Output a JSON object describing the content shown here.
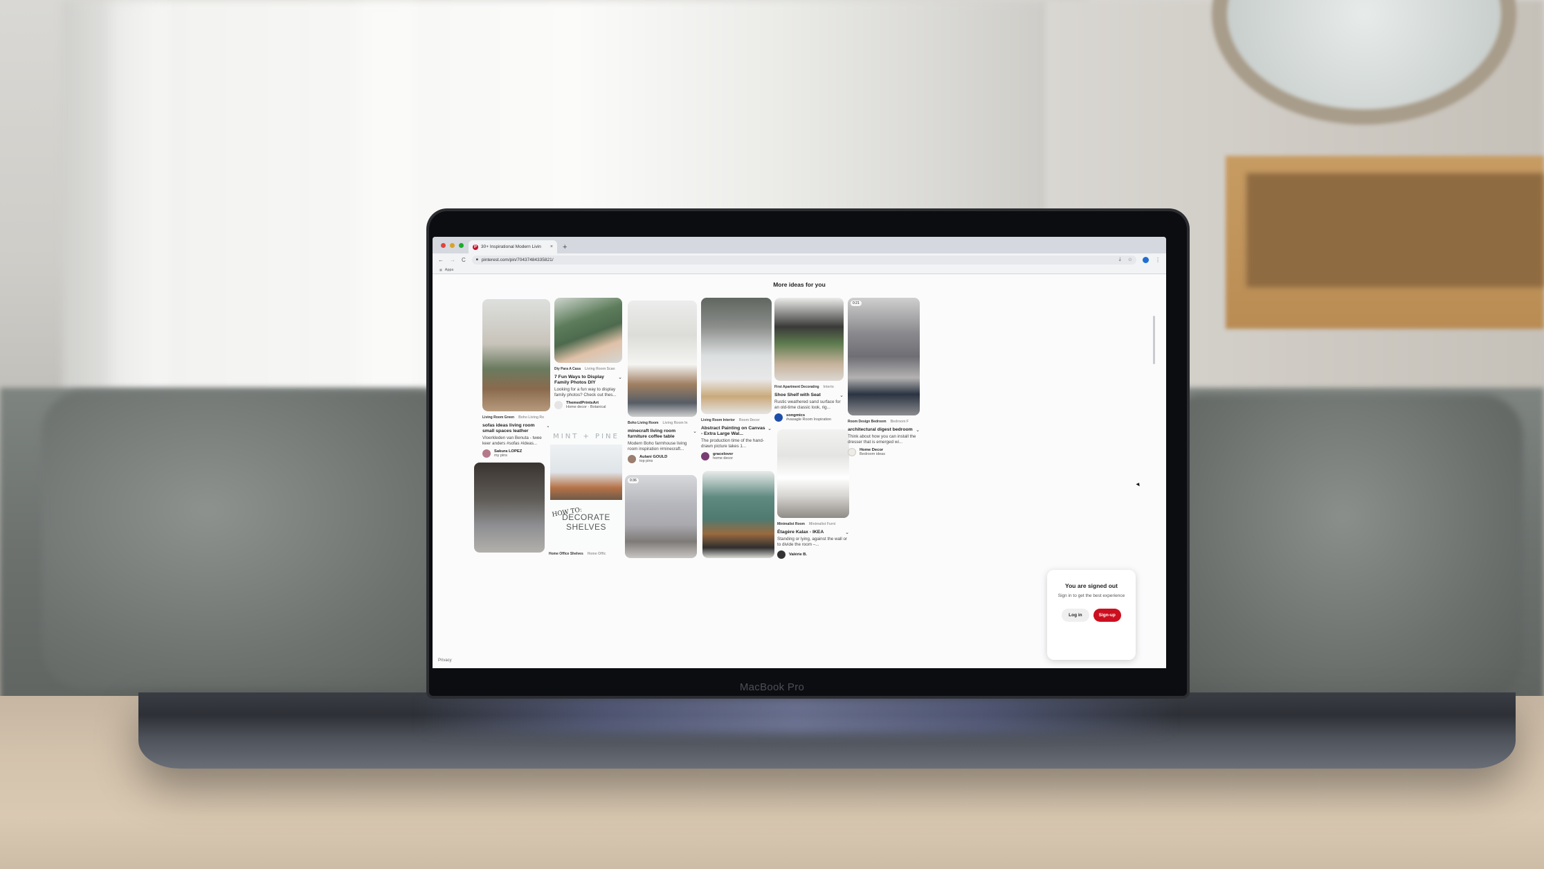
{
  "browser": {
    "tab_title": "30+ Inspirational Modern Livin",
    "new_tab_symbol": "+",
    "url": "pinterest.com/pin/70437484335821/",
    "bookmarks_label": "Apps",
    "traffic_colors": [
      "#e0443e",
      "#dea123",
      "#1aab29"
    ]
  },
  "page": {
    "heading": "More ideas for you",
    "privacy_link": "Privacy"
  },
  "pins": [
    {
      "chips": [
        "Living Room Green",
        "Boho Living Ro"
      ],
      "title": "sofas ideas living room small spaces leather",
      "desc": "Vloerkleden van Benuta - twee keer anders #sofas #ideas...",
      "author": "Sakura LOPEZ",
      "board": "my pins"
    },
    {
      "chips": [
        "Diy Para A Casa",
        "Living Room Scan"
      ],
      "title": "7 Fun Ways to Display Family Photos DIY",
      "desc": "Looking for a fun way to display family photos? Check out thes...",
      "author": "ThemedPrintsArt",
      "board": "Home decor - Botanical"
    },
    {
      "chips": [
        "Boho Living Room",
        "Living Room In"
      ],
      "title": "minecraft living room furniture coffee table",
      "desc": "Modern Boho farmhouse living room inspiration #minecraft...",
      "author": "Aulani GOULD",
      "board": "top pins"
    },
    {
      "chips": [
        "Living Room Interior",
        "Room Decor"
      ],
      "title": "Abstract Painting on Canvas - Extra Large Wal...",
      "desc": "The production time of the hand-drawn picture takes 1...",
      "author": "gracelover",
      "board": "home decor"
    },
    {
      "chips": [
        "First Apartment Decorating",
        "Interio"
      ],
      "title": "Shoe Shelf with Seat",
      "desc": "Rustic weathered sand surface for an old-time classic look, rig...",
      "author": "songmics",
      "board": "#vasagle Room Inspiration"
    },
    {
      "chips": [
        "Room Design Bedroom",
        "Bedroom F"
      ],
      "title": "architectural digest bedroom",
      "desc": "Think about how you can install the dresser that is emerged wi...",
      "author": "Home Decor",
      "board": "Bedroom ideas",
      "video_time": "0:21"
    },
    {
      "chips": [
        "Minimalist Room",
        "Minimalist Furni"
      ],
      "title": "Étagère Kalax - IKEA",
      "desc": "Standing or lying, against the wall or to divide the room –...",
      "author": "Valérie B.",
      "board": ""
    }
  ],
  "mint_pin": {
    "logo": "MINT + PINE",
    "howto": "HOW TO:",
    "headline_1": "DECORATE",
    "headline_2": "SHELVES",
    "chips": [
      "Home Office Shelves",
      "Home Offic"
    ]
  },
  "video_pin": {
    "video_time": "0:36"
  },
  "signed_out": {
    "title": "You are signed out",
    "subtitle": "Sign in to get the best experience",
    "login_label": "Log in",
    "signup_label": "Sign-up",
    "signup_color": "#cc0f1f"
  },
  "device": {
    "label": "MacBook Pro"
  },
  "icons": {
    "back": "←",
    "forward": "→",
    "reload": "C",
    "lock": "🔒",
    "download": "⤓",
    "star": "☆",
    "kebab": "⋮",
    "chevron": "⌄",
    "apps": "⋮⋮⋮",
    "close": "×"
  }
}
